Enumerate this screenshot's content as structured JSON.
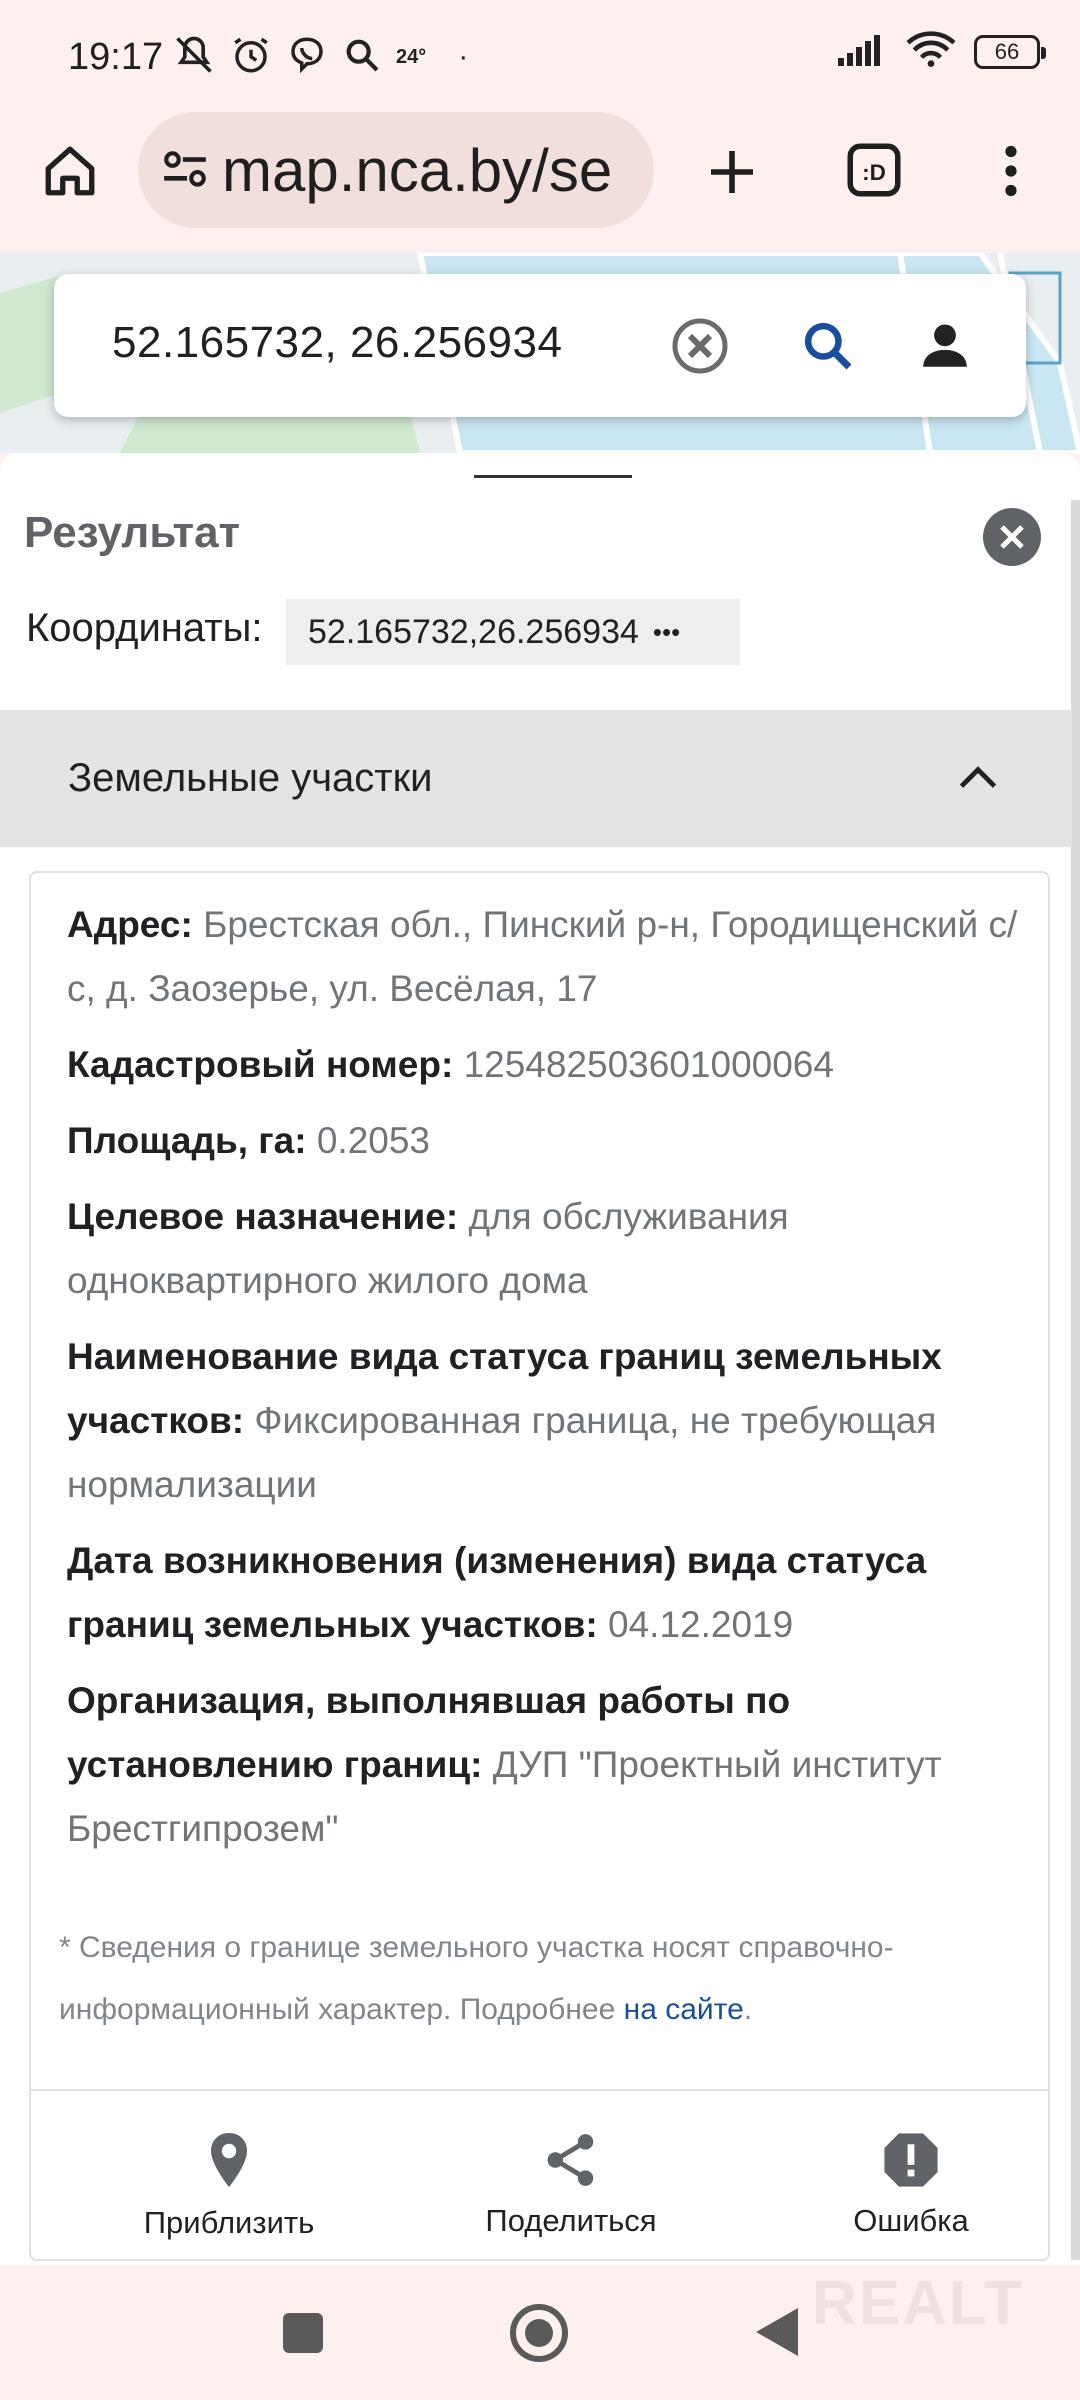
{
  "status_bar": {
    "time": "19:17",
    "temperature": "24°",
    "battery": "66"
  },
  "browser": {
    "url": "map.nca.by/se"
  },
  "search": {
    "value": "52.165732, 26.256934"
  },
  "result": {
    "title": "Результат",
    "coords_label": "Координаты:",
    "coords_value": "52.165732,26.256934",
    "coords_more": "•••"
  },
  "accordion": {
    "title": "Земельные участки"
  },
  "fields": [
    {
      "key": "Адрес:",
      "value": "Брестская обл., Пинский р-н, Городищенский с/с, д. Заозерье, ул. Весёлая, 17"
    },
    {
      "key": "Кадастровый номер:",
      "value": "125482503601000064"
    },
    {
      "key": "Площадь, га:",
      "value": "0.2053"
    },
    {
      "key": "Целевое назначение:",
      "value": "для обслуживания одноквартирного жилого дома"
    },
    {
      "key": "Наименование вида статуса границ земельных участков:",
      "value": "Фиксированная граница, не требующая нормализации"
    },
    {
      "key": "Дата возникновения (изменения) вида статуса границ земельных участков:",
      "value": "04.12.2019"
    },
    {
      "key": "Организация, выполнявшая работы по установлению границ:",
      "value": "ДУП \"Проектный институт Брестгипрозем\""
    }
  ],
  "note": {
    "text": "* Сведения о границе земельного участка носят справочно-информационный характер. Подробнее ",
    "link": "на сайте",
    "end": "."
  },
  "actions": {
    "zoom": "Приблизить",
    "share": "Поделиться",
    "error": "Ошибка"
  },
  "watermark": "REALT",
  "colors": {
    "accent_blue": "#1a4d9c",
    "map_green": "#cfe8cf",
    "map_blue": "#c9e6f2"
  }
}
